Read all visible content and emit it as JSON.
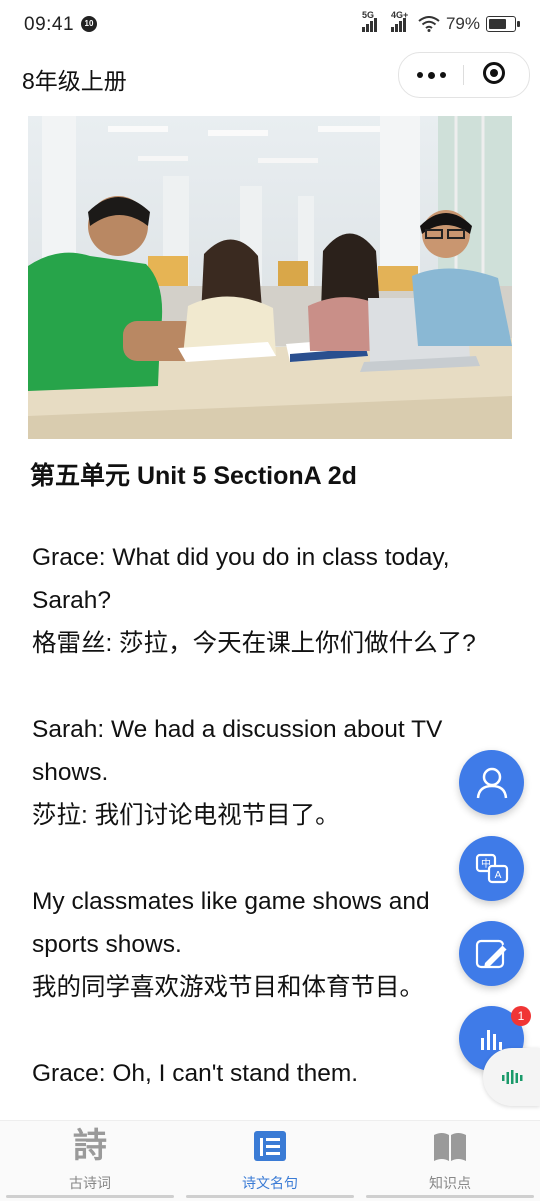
{
  "status_bar": {
    "time": "09:41",
    "notification_badge": "10",
    "network_1": "5G",
    "network_2": "4G+",
    "battery": "79%"
  },
  "header": {
    "title": "8年级上册"
  },
  "article": {
    "title": "第五单元 Unit 5 SectionA 2d",
    "lines": [
      "Grace: What did you do in class today, Sarah?",
      "格雷丝: 莎拉，今天在课上你们做什么了?",
      "Sarah: We had a discussion about TV shows.",
      "莎拉: 我们讨论电视节目了。",
      "My classmates like game shows and sports shows.",
      "我的同学喜欢游戏节目和体育节目。",
      "Grace: Oh, I can't stand them."
    ]
  },
  "fabs": {
    "badge_count": "1",
    "icons": [
      "user-icon",
      "translate-icon",
      "edit-icon",
      "audio-icon"
    ]
  },
  "tabs": [
    {
      "label": "古诗词",
      "icon_char": "詩",
      "active": false
    },
    {
      "label": "诗文名句",
      "active": true
    },
    {
      "label": "知识点",
      "active": false
    }
  ],
  "colors": {
    "accent": "#3f7be8",
    "tab_active": "#3a7bd5",
    "badge": "#f03535"
  }
}
